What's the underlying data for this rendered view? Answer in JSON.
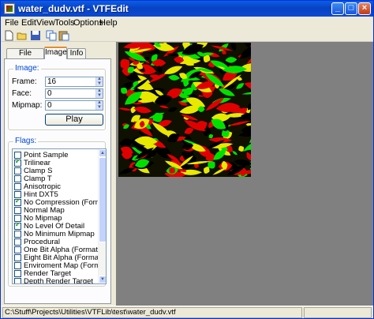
{
  "window": {
    "title": "water_dudv.vtf - VTFEdit"
  },
  "menu": [
    "File",
    "Edit",
    "View",
    "Tools",
    "Options",
    "Help"
  ],
  "toolbar": [
    "new-icon",
    "open-icon",
    "save-icon",
    "copy-icon",
    "paste-icon"
  ],
  "tabs": [
    "File System",
    "Image",
    "Info"
  ],
  "image_group": {
    "label": "Image:",
    "frame_label": "Frame:",
    "frame_value": "16",
    "face_label": "Face:",
    "face_value": "0",
    "mipmap_label": "Mipmap:",
    "mipmap_value": "0",
    "play_label": "Play"
  },
  "flags_group": {
    "label": "Flags:",
    "items": [
      {
        "label": "Point Sample",
        "checked": false
      },
      {
        "label": "Trilinear",
        "checked": true
      },
      {
        "label": "Clamp S",
        "checked": false
      },
      {
        "label": "Clamp T",
        "checked": false
      },
      {
        "label": "Anisotropic",
        "checked": false
      },
      {
        "label": "Hint DXT5",
        "checked": false
      },
      {
        "label": "No Compression (Form",
        "checked": true
      },
      {
        "label": "Normal Map",
        "checked": false
      },
      {
        "label": "No Mipmap",
        "checked": false
      },
      {
        "label": "No Level Of Detail",
        "checked": true
      },
      {
        "label": "No Minimum Mipmap",
        "checked": false
      },
      {
        "label": "Procedural",
        "checked": false
      },
      {
        "label": "One Bit Alpha (Format",
        "checked": false
      },
      {
        "label": "Eight Bit Alpha (Format",
        "checked": false
      },
      {
        "label": "Enviroment Map (Form",
        "checked": false
      },
      {
        "label": "Render Target",
        "checked": false
      },
      {
        "label": "Depth Render Target",
        "checked": false
      }
    ]
  },
  "status": {
    "path": "C:\\Stuff\\Projects\\Utilities\\VTFLib\\test\\water_dudv.vtf"
  },
  "colors": {
    "texture_red": "#e00000",
    "texture_green": "#00e000",
    "texture_yellow": "#e8e800",
    "viewport_bg": "#808080"
  }
}
